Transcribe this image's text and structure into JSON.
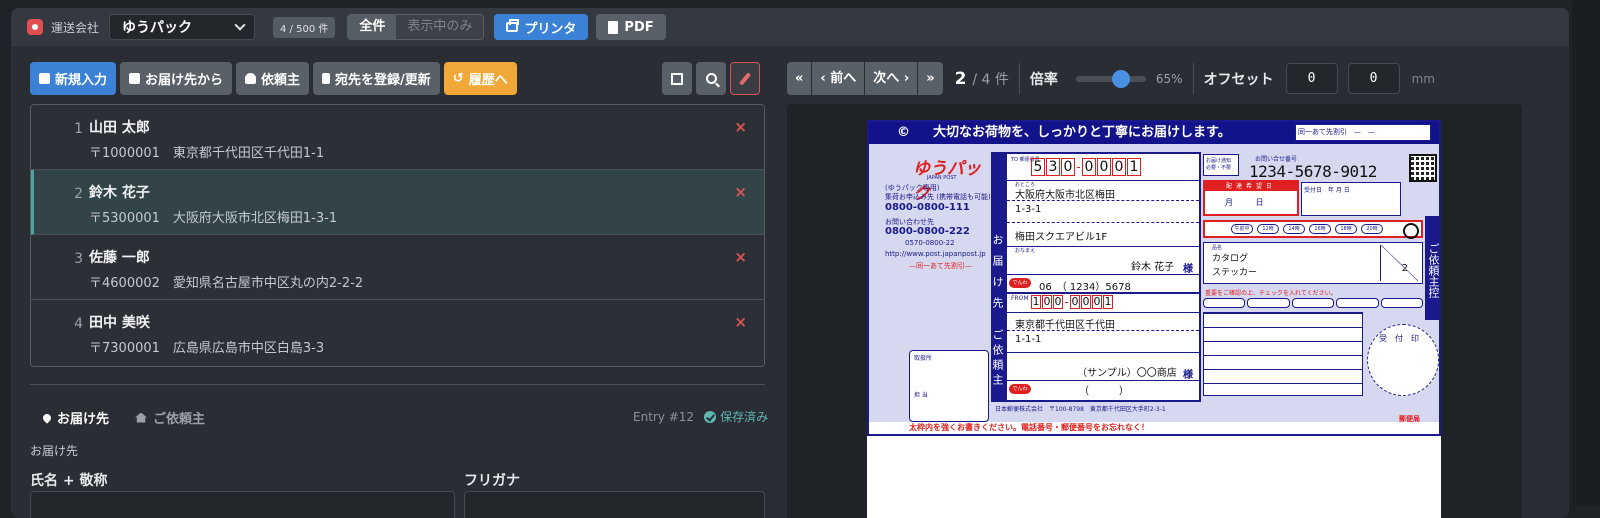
{
  "topbar": {
    "carrier_label": "運送会社",
    "carrier_value": "ゆうパック",
    "count_badge": "4 / 500 件",
    "filter_all": "全件",
    "filter_visible": "表示中のみ",
    "print_label": "プリンタ",
    "pdf_label": "PDF"
  },
  "left_toolbar": {
    "new_entry": "新規入力",
    "from_recipient": "お届け先から",
    "sender": "依頼主",
    "register_address": "宛先を登録/更新",
    "history": "履歴へ"
  },
  "entries": [
    {
      "num": "1",
      "name": "山田 太郎",
      "address": "〒1000001　東京都千代田区千代田1-1"
    },
    {
      "num": "2",
      "name": "鈴木 花子",
      "address": "〒5300001　大阪府大阪市北区梅田1-3-1"
    },
    {
      "num": "3",
      "name": "佐藤 一郎",
      "address": "〒4600002　愛知県名古屋市中区丸の内2-2-2"
    },
    {
      "num": "4",
      "name": "田中 美咲",
      "address": "〒7300001　広島県広島市中区白島3-3"
    }
  ],
  "delete_glyph": "×",
  "form": {
    "tab_recipient": "お届け先",
    "tab_sender": "ご依頼主",
    "entry_id": "Entry #12",
    "saved": "保存済み",
    "section_label": "お届け先",
    "name_label": "氏名 + 敬称",
    "kana_label": "フリガナ"
  },
  "pager": {
    "first": "«",
    "prev": "‹ 前へ",
    "next": "次へ ›",
    "last": "»",
    "current": "2",
    "total": "/ 4 件",
    "zoom_label": "倍率",
    "zoom_pct": "65%",
    "zoom_value": 0.65,
    "offset_label": "オフセット",
    "offset_x": "0",
    "offset_y": "0",
    "unit": "mm"
  },
  "label": {
    "header": "大切なお荷物を、しっかりと丁寧にお届けします。",
    "header_mark": "©",
    "topright": "同一あて先割引　—　—",
    "brand": "ゆうパック",
    "brand_sub": "JAPAN POST",
    "left_lines": [
      "(ゆうパック専用)",
      "集荷お申込み先 (携帯電話も可能)",
      "0800-0800-111",
      "お問い合わせ先",
      "0800-0800-222",
      "0570-0800-22",
      "http://www.post.japanpost.jp",
      "—同一あて先割引—"
    ],
    "receipt_place": "取扱所",
    "person_in_charge": "担 当",
    "vertical_to": "お届け先",
    "vertical_from": "ご依頼主",
    "to_zip_label": "TO 郵便番号",
    "to_zip": [
      "5",
      "3",
      "0",
      "0",
      "0",
      "0",
      "1"
    ],
    "address_label": "おところ",
    "to_addr1": "大阪府大阪市北区梅田",
    "to_addr2": "1-3-1",
    "to_addr3": "梅田スクエアビル1F",
    "name_label": "おなまえ",
    "to_name": "鈴木 花子",
    "sama": "様",
    "tel_tag": "でんわ",
    "to_tel": "06　（ 1234）5678",
    "from_tag": "FROM",
    "from_zip": [
      "1",
      "0",
      "0",
      "0",
      "0",
      "0",
      "1"
    ],
    "from_addr1": "東京都千代田区千代田",
    "from_addr2": "1-1-1",
    "from_name": "（サンプル）〇〇商店",
    "from_tel": "（　　　）",
    "notice": "お届け通知 必要・不要",
    "track_label": "お問い合せ番号",
    "track_no": "1234-5678-9012",
    "date_head": "配達希望日",
    "date_mid": "月 日",
    "deliv": "受付日　年 月 日",
    "slots": [
      "午前中",
      "12時",
      "14時",
      "16時",
      "18時",
      "20時"
    ],
    "item_label": "品名",
    "item1": "カタログ",
    "item2": "ステッカー",
    "qty": "2",
    "warn": "重要をご確認の上、チェックを入れてください。",
    "receipt_circle": "受付印",
    "vertical_right": "ご依頼主控",
    "company": "日本郵便株式会社　〒100-8798　東京都千代田区大手町2-3-1",
    "logo": "郵便局",
    "bottom_warn": "太枠内を強くお書きください。電話番号・郵便番号をお忘れなく！"
  }
}
